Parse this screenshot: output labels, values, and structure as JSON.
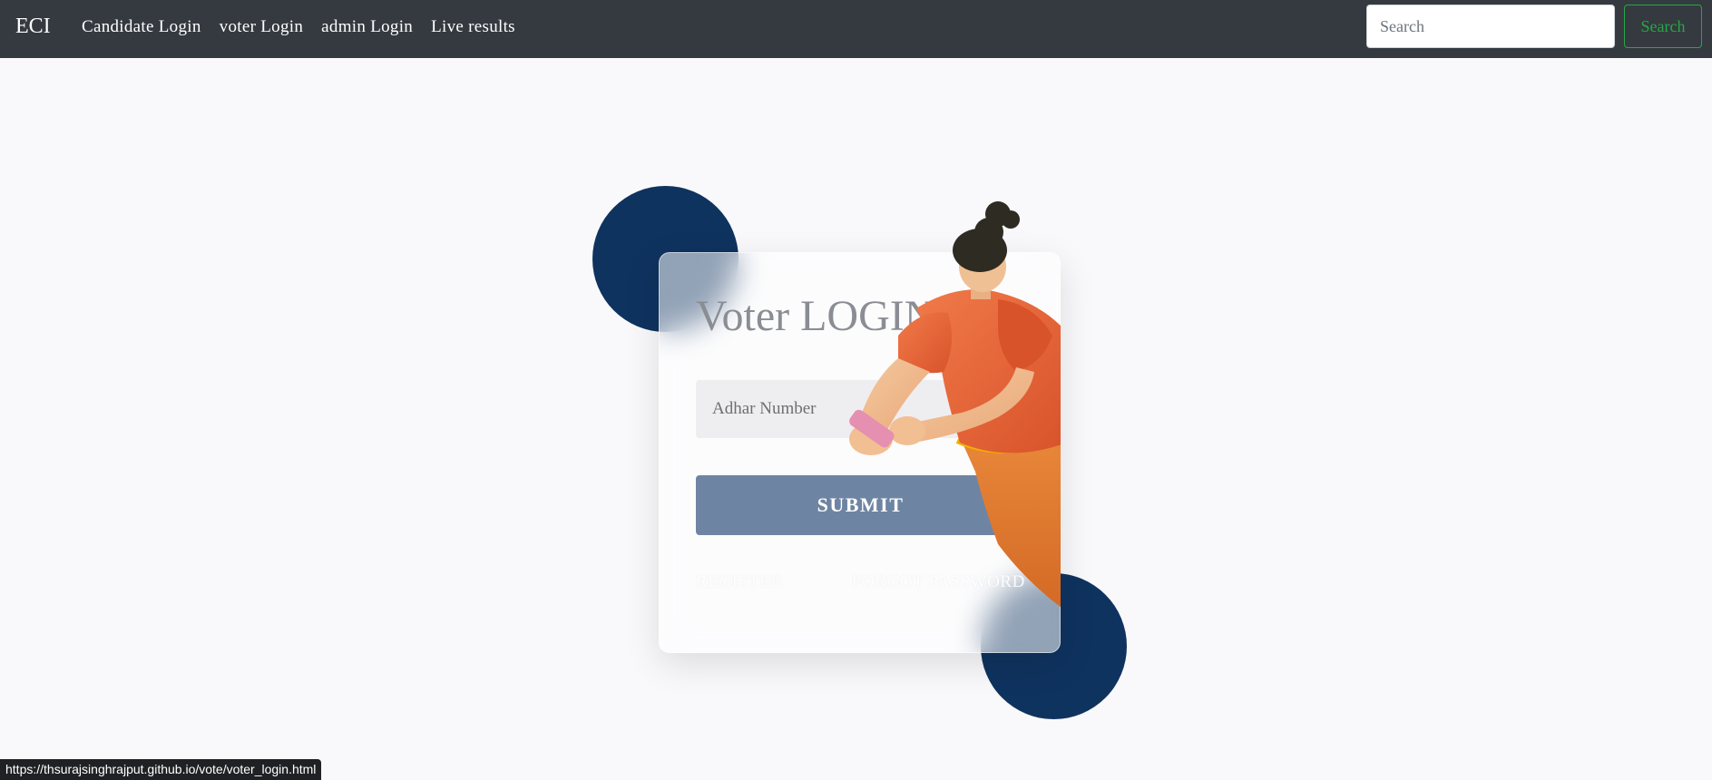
{
  "navbar": {
    "brand": "ECI",
    "links": [
      {
        "label": "Candidate Login"
      },
      {
        "label": "voter Login"
      },
      {
        "label": "admin Login"
      },
      {
        "label": "Live results"
      }
    ],
    "search": {
      "placeholder": "Search",
      "button_label": "Search"
    }
  },
  "login_card": {
    "title": "Voter LOGIN",
    "adhar_placeholder": "Adhar Number",
    "submit_label": "SUBMIT",
    "register_label": "REGISTER",
    "forgot_label": "FORGOT PASSWORD"
  },
  "status_bar": {
    "url": "https://thsurajsinghrajput.github.io/vote/voter_login.html"
  },
  "colors": {
    "navbar": "#343a40",
    "circle": "#0f335f",
    "submit": "#6e84a3",
    "search_accent": "#28a745",
    "shirt": "#e8643a"
  }
}
